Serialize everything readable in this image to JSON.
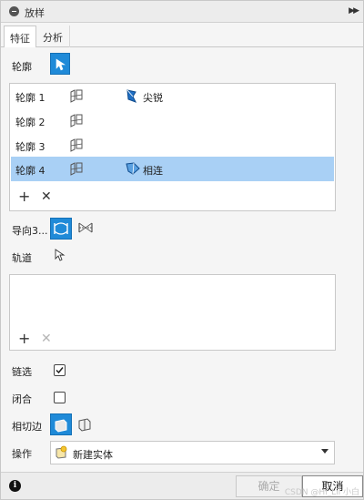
{
  "title": "放样",
  "tabs": [
    "特征",
    "分析"
  ],
  "profile_label": "轮廓",
  "profiles": [
    {
      "name": "轮廓 1",
      "condition": "尖锐"
    },
    {
      "name": "轮廓 2",
      "condition": ""
    },
    {
      "name": "轮廓 3",
      "condition": ""
    },
    {
      "name": "轮廓 4",
      "condition": "相连"
    }
  ],
  "guide_label": "导向3...",
  "rail_label": "轨道",
  "chain_label": "链选",
  "closed_label": "闭合",
  "tangent_label": "相切边",
  "operation_label": "操作",
  "operation_value": "新建实体",
  "ok_label": "确定",
  "cancel_label": "取消",
  "watermark": "CSDN @Hi_Lil 小白",
  "chain_checked": true,
  "closed_checked": false,
  "accent_color": "#1f8ad8",
  "selected_row_color": "#a9d0f5"
}
